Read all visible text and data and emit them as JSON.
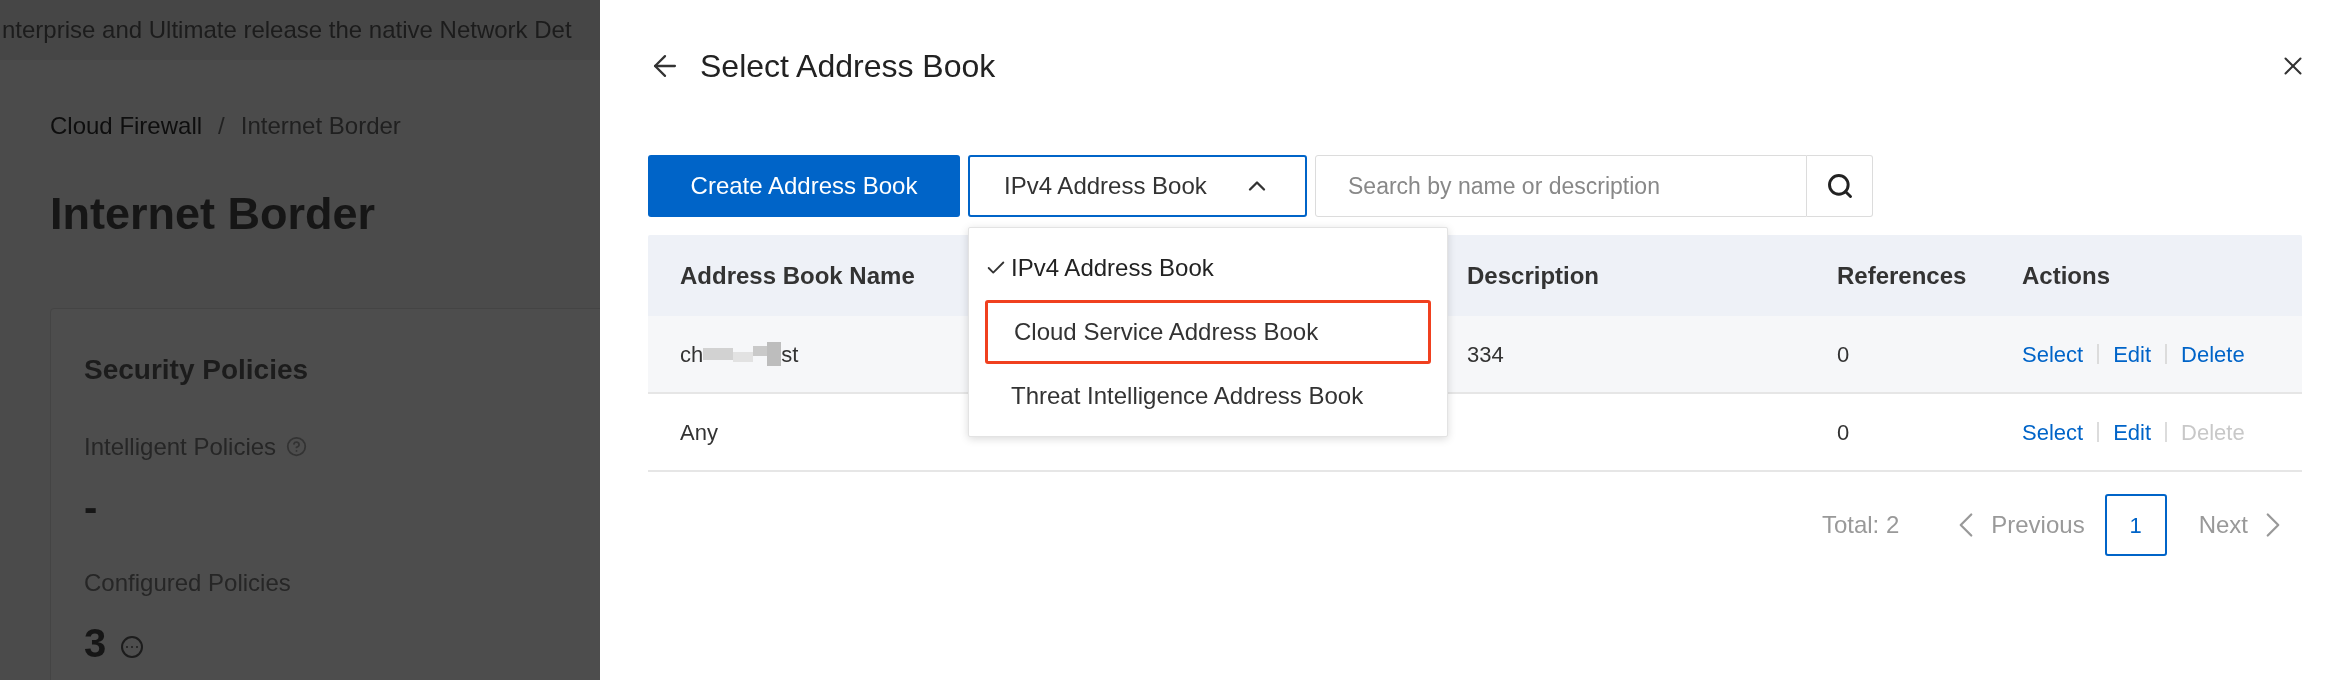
{
  "background": {
    "banner": "nterprise and Ultimate release the native Network Det",
    "breadcrumb_separator": "/",
    "breadcrumb": [
      {
        "label": "Cloud Firewall",
        "current": false
      },
      {
        "label": "Internet Border",
        "current": true
      }
    ],
    "title": "Internet Border",
    "card": {
      "title": "Security Policies",
      "stats": [
        {
          "label": "Intelligent Policies",
          "help": true,
          "value": "-"
        },
        {
          "label": "Configured Policies",
          "value": "3",
          "more": true
        }
      ]
    }
  },
  "drawer": {
    "title": "Select Address Book",
    "create_button": "Create Address Book",
    "type_select": {
      "value": "IPv4 Address Book",
      "expanded": true,
      "options": [
        {
          "label": "IPv4 Address Book",
          "selected": true,
          "highlighted": false
        },
        {
          "label": "Cloud Service Address Book",
          "selected": false,
          "highlighted": true
        },
        {
          "label": "Threat Intelligence Address Book",
          "selected": false,
          "highlighted": false
        }
      ]
    },
    "search": {
      "placeholder": "Search by name or description"
    },
    "table": {
      "columns": [
        "Address Book Name",
        "Description",
        "References",
        "Actions"
      ],
      "rows": [
        {
          "name_parts": [
            "ch",
            "st"
          ],
          "redacted": true,
          "highlighted": true,
          "description": "334",
          "references": "0",
          "actions": [
            {
              "label": "Select",
              "disabled": false
            },
            {
              "label": "Edit",
              "disabled": false
            },
            {
              "label": "Delete",
              "disabled": false
            }
          ]
        },
        {
          "name_parts": [
            "Any"
          ],
          "redacted": false,
          "highlighted": false,
          "description": "",
          "references": "0",
          "actions": [
            {
              "label": "Select",
              "disabled": false
            },
            {
              "label": "Edit",
              "disabled": false
            },
            {
              "label": "Delete",
              "disabled": true
            }
          ]
        }
      ]
    },
    "pagination": {
      "total": "Total: 2",
      "previous": "Previous",
      "pages": [
        {
          "label": "1",
          "selected": true
        }
      ],
      "next": "Next"
    }
  }
}
